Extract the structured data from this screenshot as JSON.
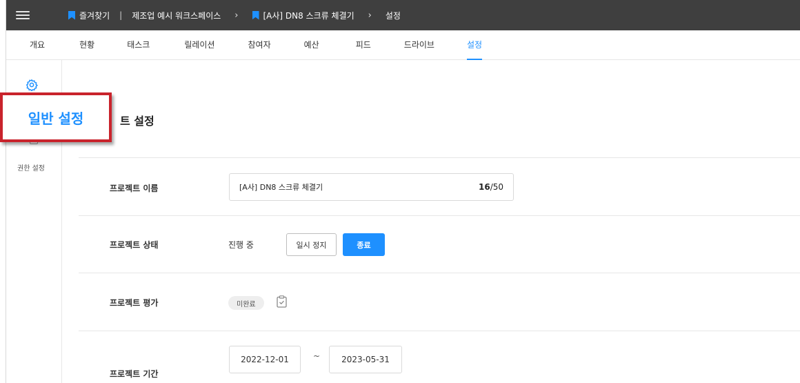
{
  "breadcrumb": {
    "favorites": "즐겨찾기",
    "separator": "|",
    "workspace": "제조업 예시 워크스페이스",
    "project": "[A사] DN8 스크류 체결기",
    "current": "설정",
    "chevron": "›"
  },
  "tabs": [
    {
      "label": "개요",
      "active": false
    },
    {
      "label": "현황",
      "active": false
    },
    {
      "label": "태스크",
      "active": false
    },
    {
      "label": "릴레이션",
      "active": false
    },
    {
      "label": "참여자",
      "active": false
    },
    {
      "label": "예산",
      "active": false
    },
    {
      "label": "피드",
      "active": false
    },
    {
      "label": "드라이브",
      "active": false
    },
    {
      "label": "설정",
      "active": true
    }
  ],
  "sidebar": {
    "general_icon": "gear-icon",
    "permission_label": "권한 설정"
  },
  "callout": {
    "label": "일반 설정"
  },
  "section": {
    "title_visible": "트 설정"
  },
  "form": {
    "name_label": "프로젝트 이름",
    "name_value": "[A사] DN8 스크류 체결기",
    "name_count": "16",
    "name_max": "/50",
    "status_label": "프로젝트 상태",
    "status_value": "진행 중",
    "pause_button": "일시 정지",
    "end_button": "종료",
    "eval_label": "프로젝트 평가",
    "eval_badge": "미완료",
    "period_label": "프로젝트 기간",
    "start_date": "2022-12-01",
    "tilde": "~",
    "end_date": "2023-05-31"
  },
  "colors": {
    "accent": "#1e90ff",
    "topbar": "#3f3f3f",
    "callout_border": "#c9232c"
  }
}
